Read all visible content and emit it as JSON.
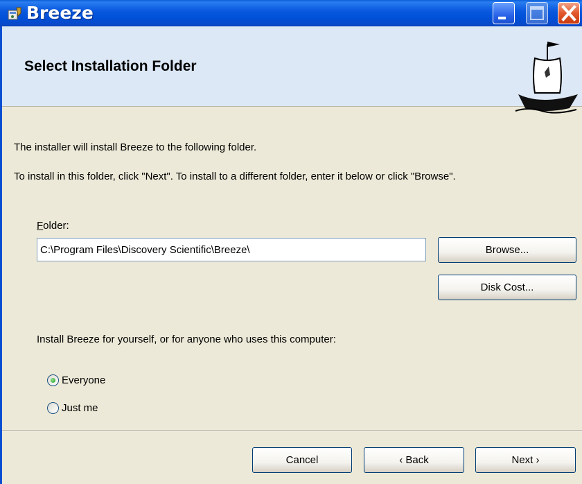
{
  "window": {
    "title": "Breeze"
  },
  "header": {
    "title": "Select Installation Folder"
  },
  "body": {
    "line1": "The installer will install Breeze to the following folder.",
    "line2": "To install in this folder, click \"Next\". To install to a different folder, enter it below or click \"Browse\"."
  },
  "folder": {
    "label_mnemonic": "F",
    "label_rest": "older:",
    "value": "C:\\Program Files\\Discovery Scientific\\Breeze\\"
  },
  "buttons": {
    "browse": "Browse...",
    "disk_cost": "Disk Cost...",
    "cancel": "Cancel",
    "back": "‹ Back",
    "next": "Next ›"
  },
  "install_for": {
    "prompt": "Install Breeze for yourself, or for anyone who uses this computer:",
    "options": [
      {
        "label": "Everyone",
        "checked": true
      },
      {
        "label": "Just me",
        "checked": false
      }
    ]
  },
  "colors": {
    "titlebar": "#0050d8",
    "banner": "#dce8f5",
    "dialog_bg": "#ece9d8",
    "close_button": "#e2582c"
  }
}
